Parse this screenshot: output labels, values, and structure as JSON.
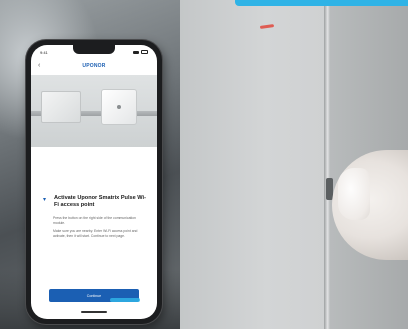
{
  "phone": {
    "status_time": "9:41",
    "brand": "UPONOR",
    "back_icon": "chevron-left-icon",
    "step_title": "Activate Uponor Smatrix Pulse Wi-Fi access point",
    "bullets": [
      "Press the button on the right side of the communication module.",
      "Make sure you are nearby. Enter Wi-Fi access point and activate, then it will start. Continue to next page."
    ],
    "cta_label": "Continue"
  },
  "colors": {
    "brand_blue": "#1b5fb3",
    "accent_cyan": "#2fb3e6",
    "red_mark": "#e0463c"
  }
}
